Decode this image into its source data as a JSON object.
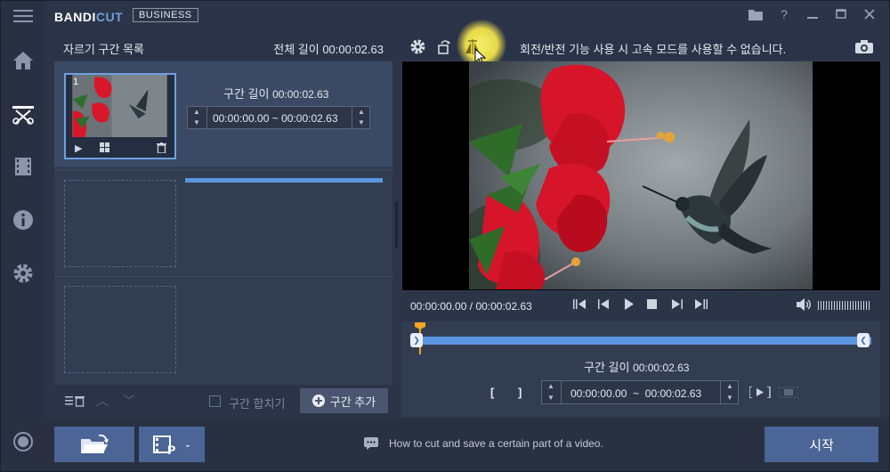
{
  "app": {
    "brand_a": "BANDI",
    "brand_b": "CUT",
    "edition": "BUSINESS"
  },
  "left_panel": {
    "title": "자르기 구간 목록",
    "total_length": "전체 길이 00:00:02.63",
    "segment": {
      "index": "1",
      "length_label": "구간 길이",
      "length_value": "00:00:02.63",
      "start": "00:00:00.00",
      "separator": "~",
      "end": "00:00:02.63",
      "progress": 1.0
    },
    "merge_label": "구간 합치기",
    "add_label": "구간 추가"
  },
  "right_panel": {
    "message": "회전/반전 기능 사용 시 고속 모드를 사용할 수 없습니다.",
    "time_current": "00:00:00.00",
    "time_sep": "/",
    "time_total": "00:00:02.63",
    "segment_length_label": "구간 길이",
    "segment_length_value": "00:00:02.63",
    "range_start": "00:00:00.00",
    "range_sep": "~",
    "range_end": "00:00:02.63"
  },
  "bottom": {
    "tip": "How to cut and save a certain part of a video.",
    "start_label": "시작"
  },
  "colors": {
    "accent": "#5a95e0",
    "marker": "#f5a623",
    "highlight": "#f0e65a"
  }
}
